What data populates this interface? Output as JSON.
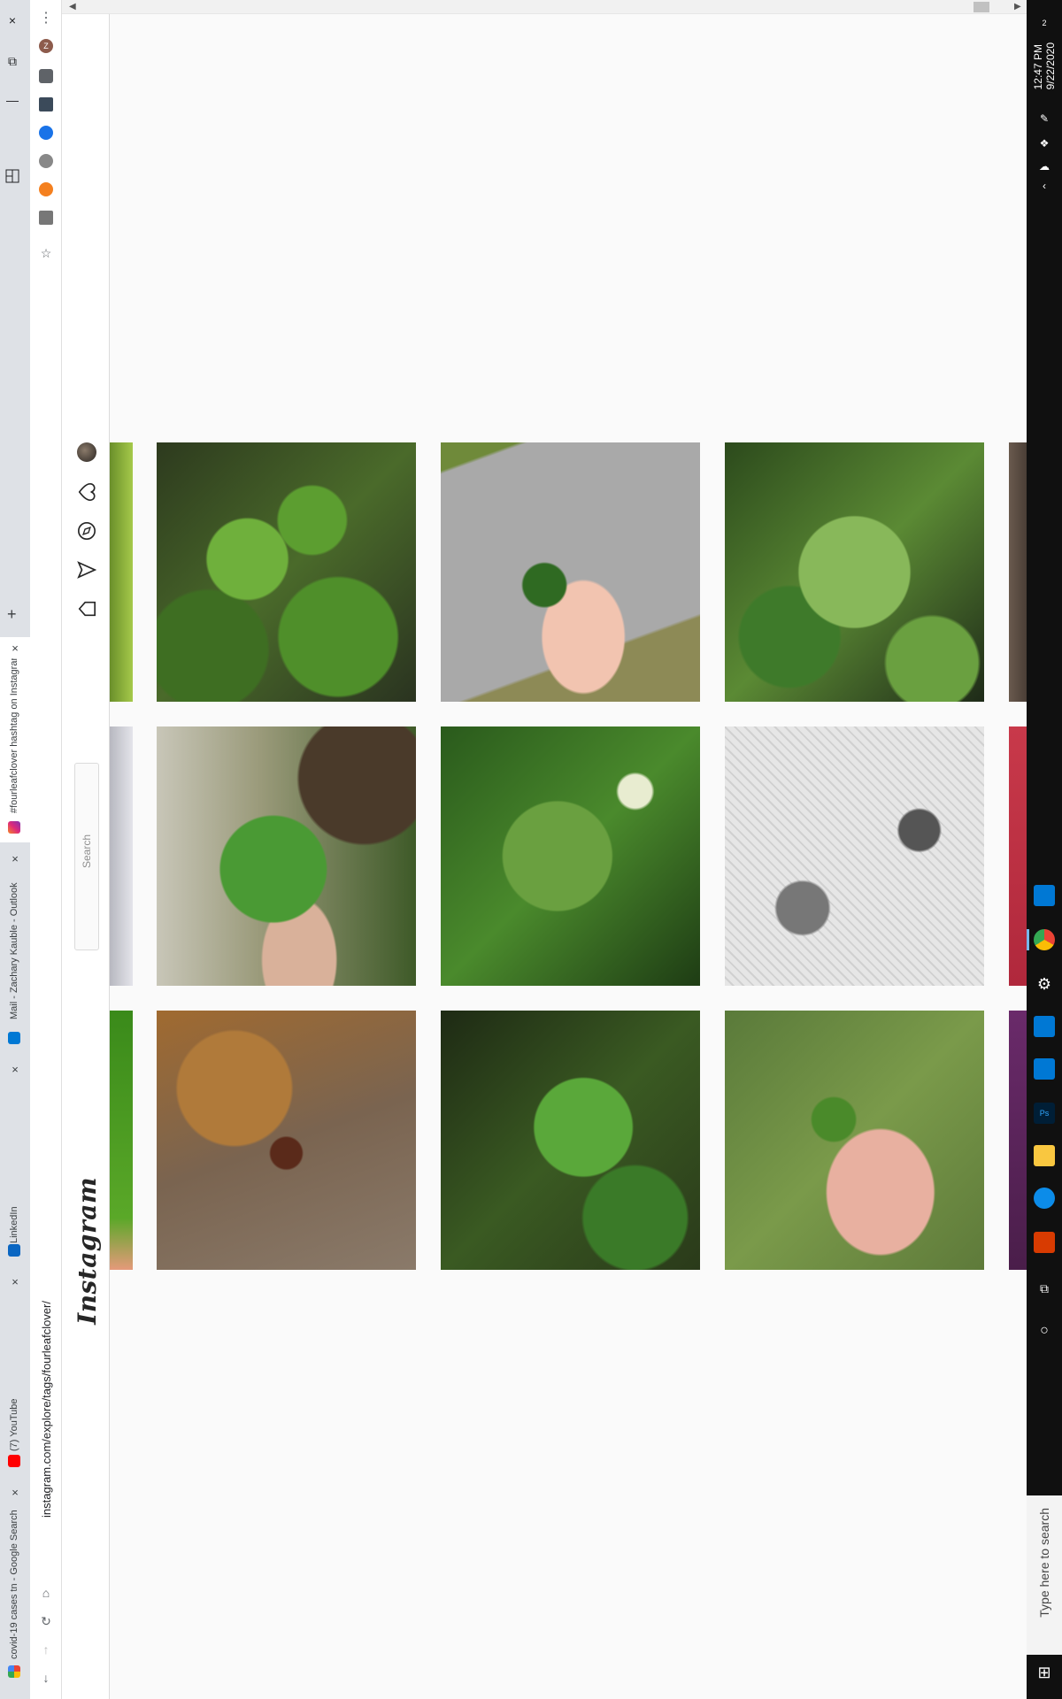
{
  "browser": {
    "window_controls": [
      "×",
      "⧉",
      "—"
    ],
    "new_tab_label": "+",
    "tabs": [
      {
        "title": "covid-19 cases tn - Google Search",
        "favicon": "google-icon",
        "color": "#4285f4",
        "active": false
      },
      {
        "title": "(7) YouTube",
        "favicon": "youtube-icon",
        "color": "#ff0000",
        "active": false
      },
      {
        "title": "LinkedIn",
        "favicon": "linkedin-icon",
        "color": "#0a66c2",
        "active": false
      },
      {
        "title": "Mail - Zachary Kauble - Outlook",
        "favicon": "outlook-icon",
        "color": "#0078d4",
        "active": false
      },
      {
        "title": "#fourleafclover hashtag on Instagram",
        "favicon": "instagram-icon",
        "color": "#d6249f",
        "active": true
      }
    ],
    "url": "instagram.com/explore/tags/fourleafclover/",
    "toolbar": {
      "menu_icon": "⋮",
      "profile_initial": "Z",
      "back_icon": "↓",
      "forward_icon": "↑",
      "reload_icon": "↻",
      "home_icon": "⌂"
    },
    "extensions": [
      {
        "name": "puzzle-extension-icon",
        "color": "#5f6368"
      },
      {
        "name": "monitor-extension-icon",
        "color": "#3b4a5a"
      },
      {
        "name": "blue-circle-extension-icon",
        "color": "#1a73e8"
      },
      {
        "name": "grey-circle-extension-icon",
        "color": "#888888"
      },
      {
        "name": "orange-extension-icon",
        "color": "#f4801f"
      },
      {
        "name": "grey-square-extension-icon",
        "color": "#777777"
      }
    ],
    "bookmark_icon": "☆"
  },
  "instagram": {
    "logo": "Instagram",
    "search_placeholder": "Search",
    "nav_icons": [
      "home-icon",
      "direct-icon",
      "explore-icon",
      "activity-heart-icon",
      "profile-avatar"
    ]
  },
  "taskbar": {
    "time": "12:47 PM",
    "date": "9/22/2020",
    "search_placeholder": "Type here to search",
    "notification_count": "2",
    "pinned": [
      {
        "name": "task-view-icon",
        "color": "#101010"
      },
      {
        "name": "office-icon",
        "color": "#d83b01"
      },
      {
        "name": "edge-icon",
        "color": "#0c8ce9"
      },
      {
        "name": "file-explorer-icon",
        "color": "#f9c740"
      },
      {
        "name": "photoshop-icon",
        "color": "#001e36"
      },
      {
        "name": "visual-studio-code-icon",
        "color": "#0078d4"
      },
      {
        "name": "outlook-icon",
        "color": "#0078d4"
      },
      {
        "name": "settings-icon",
        "color": "#101010"
      },
      {
        "name": "chrome-icon",
        "color": "#4285f4"
      },
      {
        "name": "blue-app-icon",
        "color": "#0078d4"
      }
    ]
  }
}
